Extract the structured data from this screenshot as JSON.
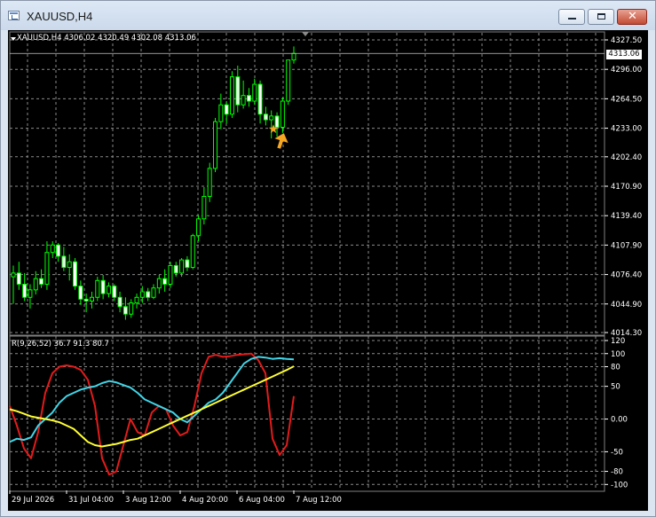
{
  "window": {
    "title": "XAUUSD,H4",
    "buttons": {
      "minimize": "minimize",
      "maximize": "maximize",
      "close": "✕"
    }
  },
  "chart": {
    "symbol_info": "XAUUSD,H4  4306.02 4320.49 4302.08 4313.06",
    "current_price": "4313.06",
    "price_axis_labels": [
      "4327.50",
      "4296.00",
      "4264.50",
      "4233.00",
      "4202.40",
      "4170.90",
      "4139.40",
      "4107.90",
      "4076.40",
      "4044.90",
      "4014.30"
    ],
    "time_axis_labels": [
      "29 Jul 2026",
      "31 Jul 04:00",
      "3 Aug 12:00",
      "4 Aug 20:00",
      "6 Aug 04:00",
      "7 Aug 12:00"
    ],
    "indicator_info": "R(9,26,52) 36.7 91.3 80.7",
    "indicator_axis_labels": [
      "120",
      "100",
      "80",
      "50",
      "0.00",
      "-50",
      "-80",
      "-100"
    ],
    "colors": {
      "background": "#000000",
      "grid": "#8a8a8a",
      "bull_candle": "#00ff00",
      "bear_candle": "#ffffff",
      "line_red": "#e31b1b",
      "line_cyan": "#3fd6e8",
      "line_yellow": "#ffff33",
      "signal_arrow": "#f5a623"
    },
    "signal_icons": [
      "star-icon",
      "up-arrow-icon"
    ]
  },
  "chart_data": {
    "type": "candlestick",
    "price_axis": {
      "ylim": [
        4014.3,
        4327.5
      ]
    },
    "candles": [
      {
        "o": 4074,
        "h": 4086,
        "l": 4045,
        "c": 4078
      },
      {
        "o": 4078,
        "h": 4090,
        "l": 4060,
        "c": 4066
      },
      {
        "o": 4066,
        "h": 4078,
        "l": 4048,
        "c": 4052
      },
      {
        "o": 4052,
        "h": 4066,
        "l": 4040,
        "c": 4060
      },
      {
        "o": 4060,
        "h": 4080,
        "l": 4055,
        "c": 4072
      },
      {
        "o": 4072,
        "h": 4082,
        "l": 4062,
        "c": 4066
      },
      {
        "o": 4066,
        "h": 4112,
        "l": 4060,
        "c": 4100
      },
      {
        "o": 4100,
        "h": 4112,
        "l": 4094,
        "c": 4108
      },
      {
        "o": 4108,
        "h": 4110,
        "l": 4090,
        "c": 4096
      },
      {
        "o": 4096,
        "h": 4106,
        "l": 4080,
        "c": 4084
      },
      {
        "o": 4084,
        "h": 4098,
        "l": 4070,
        "c": 4090
      },
      {
        "o": 4090,
        "h": 4094,
        "l": 4060,
        "c": 4064
      },
      {
        "o": 4064,
        "h": 4070,
        "l": 4044,
        "c": 4050
      },
      {
        "o": 4050,
        "h": 4056,
        "l": 4036,
        "c": 4048
      },
      {
        "o": 4048,
        "h": 4058,
        "l": 4040,
        "c": 4052
      },
      {
        "o": 4052,
        "h": 4074,
        "l": 4048,
        "c": 4070
      },
      {
        "o": 4070,
        "h": 4076,
        "l": 4050,
        "c": 4056
      },
      {
        "o": 4056,
        "h": 4068,
        "l": 4052,
        "c": 4064
      },
      {
        "o": 4064,
        "h": 4066,
        "l": 4048,
        "c": 4052
      },
      {
        "o": 4052,
        "h": 4058,
        "l": 4036,
        "c": 4042
      },
      {
        "o": 4042,
        "h": 4052,
        "l": 4028,
        "c": 4034
      },
      {
        "o": 4034,
        "h": 4050,
        "l": 4030,
        "c": 4046
      },
      {
        "o": 4046,
        "h": 4056,
        "l": 4040,
        "c": 4052
      },
      {
        "o": 4052,
        "h": 4064,
        "l": 4046,
        "c": 4058
      },
      {
        "o": 4058,
        "h": 4062,
        "l": 4048,
        "c": 4052
      },
      {
        "o": 4052,
        "h": 4066,
        "l": 4050,
        "c": 4062
      },
      {
        "o": 4062,
        "h": 4076,
        "l": 4056,
        "c": 4072
      },
      {
        "o": 4072,
        "h": 4082,
        "l": 4058,
        "c": 4066
      },
      {
        "o": 4066,
        "h": 4090,
        "l": 4062,
        "c": 4086
      },
      {
        "o": 4086,
        "h": 4090,
        "l": 4074,
        "c": 4078
      },
      {
        "o": 4078,
        "h": 4094,
        "l": 4074,
        "c": 4092
      },
      {
        "o": 4092,
        "h": 4096,
        "l": 4080,
        "c": 4084
      },
      {
        "o": 4084,
        "h": 4120,
        "l": 4082,
        "c": 4118
      },
      {
        "o": 4118,
        "h": 4140,
        "l": 4112,
        "c": 4136
      },
      {
        "o": 4136,
        "h": 4170,
        "l": 4130,
        "c": 4160
      },
      {
        "o": 4160,
        "h": 4196,
        "l": 4154,
        "c": 4190
      },
      {
        "o": 4190,
        "h": 4244,
        "l": 4186,
        "c": 4240
      },
      {
        "o": 4240,
        "h": 4270,
        "l": 4232,
        "c": 4258
      },
      {
        "o": 4258,
        "h": 4262,
        "l": 4238,
        "c": 4248
      },
      {
        "o": 4248,
        "h": 4294,
        "l": 4244,
        "c": 4288
      },
      {
        "o": 4288,
        "h": 4300,
        "l": 4250,
        "c": 4258
      },
      {
        "o": 4258,
        "h": 4284,
        "l": 4254,
        "c": 4268
      },
      {
        "o": 4268,
        "h": 4276,
        "l": 4256,
        "c": 4262
      },
      {
        "o": 4262,
        "h": 4286,
        "l": 4258,
        "c": 4280
      },
      {
        "o": 4280,
        "h": 4284,
        "l": 4238,
        "c": 4248
      },
      {
        "o": 4248,
        "h": 4256,
        "l": 4236,
        "c": 4242
      },
      {
        "o": 4242,
        "h": 4252,
        "l": 4222,
        "c": 4246
      },
      {
        "o": 4246,
        "h": 4250,
        "l": 4224,
        "c": 4234
      },
      {
        "o": 4234,
        "h": 4266,
        "l": 4228,
        "c": 4262
      },
      {
        "o": 4262,
        "h": 4296,
        "l": 4258,
        "c": 4306
      },
      {
        "o": 4306,
        "h": 4320.49,
        "l": 4302.08,
        "c": 4313.06
      }
    ],
    "indicator": {
      "name": "R(9,26,52)",
      "ylim": [
        -105,
        120
      ],
      "series": [
        {
          "name": "red",
          "values": [
            20,
            -10,
            -45,
            -60,
            -20,
            40,
            70,
            80,
            82,
            80,
            75,
            60,
            20,
            -60,
            -85,
            -80,
            -40,
            0,
            -20,
            -25,
            10,
            20,
            15,
            -10,
            -25,
            -20,
            20,
            70,
            95,
            98,
            95,
            96,
            98,
            99,
            100,
            90,
            70,
            -30,
            -55,
            -40,
            35
          ]
        },
        {
          "name": "cyan",
          "values": [
            -35,
            -30,
            -32,
            -28,
            -10,
            0,
            10,
            25,
            35,
            40,
            45,
            48,
            50,
            55,
            58,
            56,
            52,
            48,
            40,
            30,
            25,
            20,
            15,
            10,
            0,
            -5,
            5,
            15,
            25,
            30,
            40,
            55,
            70,
            85,
            92,
            95,
            94,
            92,
            93,
            92,
            91.3
          ]
        },
        {
          "name": "yellow",
          "values": [
            15,
            12,
            8,
            4,
            2,
            0,
            -2,
            -5,
            -10,
            -15,
            -25,
            -35,
            -40,
            -42,
            -40,
            -38,
            -35,
            -32,
            -30,
            -25,
            -20,
            -15,
            -10,
            -5,
            0,
            5,
            10,
            15,
            20,
            25,
            30,
            35,
            40,
            45,
            50,
            55,
            60,
            65,
            70,
            75,
            80.7
          ]
        }
      ]
    }
  }
}
